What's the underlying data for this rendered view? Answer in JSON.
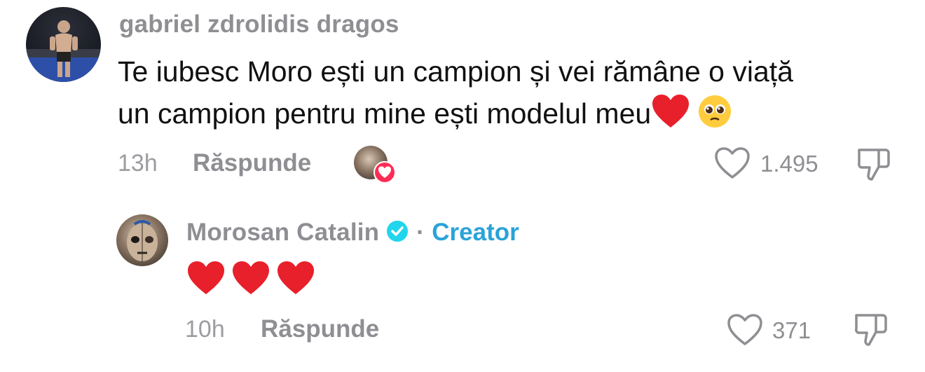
{
  "comments": [
    {
      "username": "gabriel zdrolidis dragos",
      "text_line1": "Te iubesc Moro ești un campion și vei rămâne o viață",
      "text_line2": "un campion pentru mine ești modelul meu",
      "time": "13h",
      "reply_label": "Răspunde",
      "like_count": "1.495"
    },
    {
      "username": "Morosan Catalin",
      "separator": "·",
      "creator_label": "Creator",
      "time": "10h",
      "reply_label": "Răspunde",
      "like_count": "371"
    }
  ],
  "colors": {
    "creator_accent": "#2aa3d9",
    "heart_red": "#e8202b",
    "liked_badge": "#fe2c55"
  }
}
